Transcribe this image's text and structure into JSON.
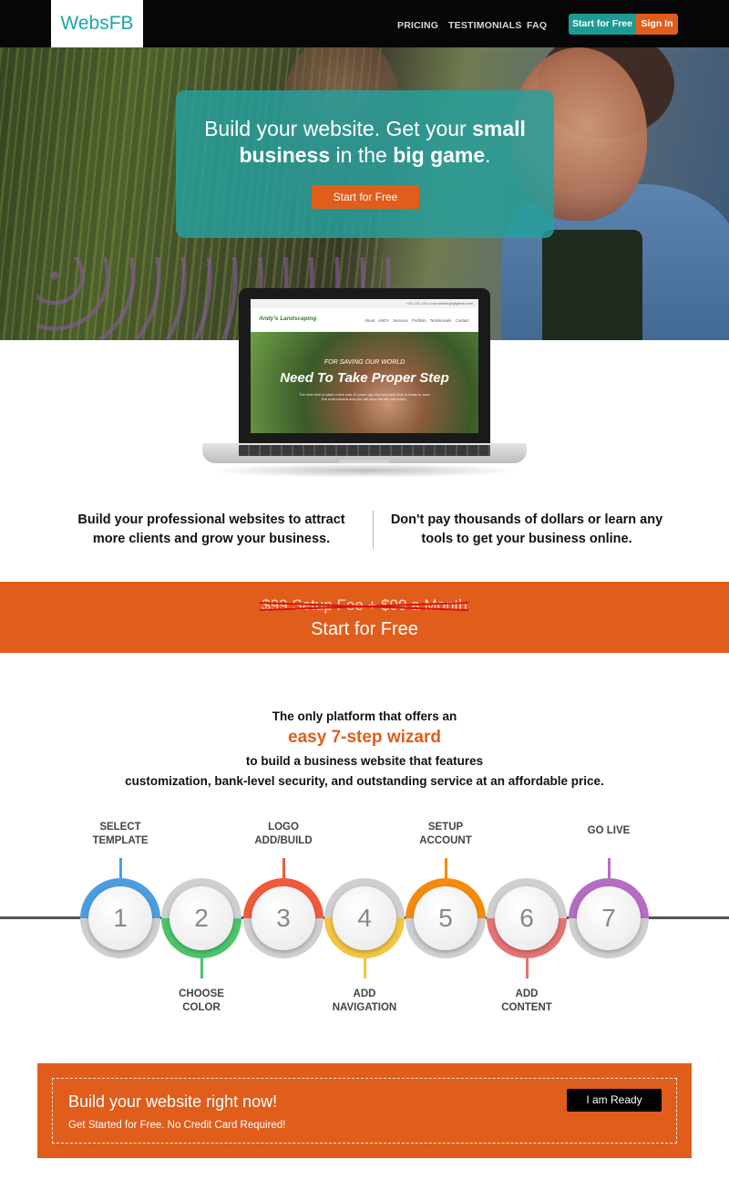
{
  "nav": {
    "logo": "WebsFB",
    "links": [
      "PRICING",
      "TESTIMONIALS",
      "FAQ"
    ],
    "start_label": "Start for Free",
    "signin_label": "Sign In"
  },
  "hero": {
    "title_part1": "Build your website. Get your ",
    "title_bold1": "small business",
    "title_part2": " in the ",
    "title_bold2": "big game",
    "title_part3": ".",
    "cta_label": "Start for Free"
  },
  "laptop_preview": {
    "topbar": "+111 111 1111   porposthabuja@gmail.com",
    "brand": "Andy's Landscaping",
    "menu": "About ANDY  Services  Portfolio  Testimonials  Contact",
    "tagline_small": "FOR SAVING OUR WORLD",
    "tagline_big": "Need To Take Proper Step",
    "tagline_body": "The best time to plant a tree was 20 years ago the next best time is today to save the environment and you will save the life and future."
  },
  "features": {
    "left": "Build your professional websites to attract more clients and grow your business.",
    "right": "Don't pay thousands of dollars or learn any tools to get your business online."
  },
  "banner": {
    "strike_text": "$99 Setup Fee + $99 a Month",
    "cta": "Start for Free"
  },
  "wizard": {
    "line1": "The only platform that offers an",
    "highlight": "easy 7-step wizard",
    "line3": "to build a business website that features",
    "line4": "customization, bank-level security, and outstanding service at an affordable price.",
    "steps": [
      {
        "num": "1",
        "label_line1": "SELECT",
        "label_line2": "TEMPLATE",
        "color": "#4a9de0"
      },
      {
        "num": "2",
        "label_line1": "CHOOSE",
        "label_line2": "COLOR",
        "color": "#4cc46a"
      },
      {
        "num": "3",
        "label_line1": "LOGO",
        "label_line2": "ADD/BUILD",
        "color": "#f05a3a"
      },
      {
        "num": "4",
        "label_line1": "ADD",
        "label_line2": "NAVIGATION",
        "color": "#f4c542"
      },
      {
        "num": "5",
        "label_line1": "SETUP",
        "label_line2": "ACCOUNT",
        "color": "#f58a0c"
      },
      {
        "num": "6",
        "label_line1": "ADD",
        "label_line2": "CONTENT",
        "color": "#e57373"
      },
      {
        "num": "7",
        "label_line1": "GO LIVE",
        "label_line2": "",
        "color": "#b56cc4"
      }
    ]
  },
  "cta": {
    "title": "Build your website right now!",
    "subtitle": "Get Started for Free. No Credit Card Required!",
    "button": "I am Ready"
  },
  "colors": {
    "brand_teal": "#1d9a93",
    "brand_orange": "#e05d1c"
  }
}
